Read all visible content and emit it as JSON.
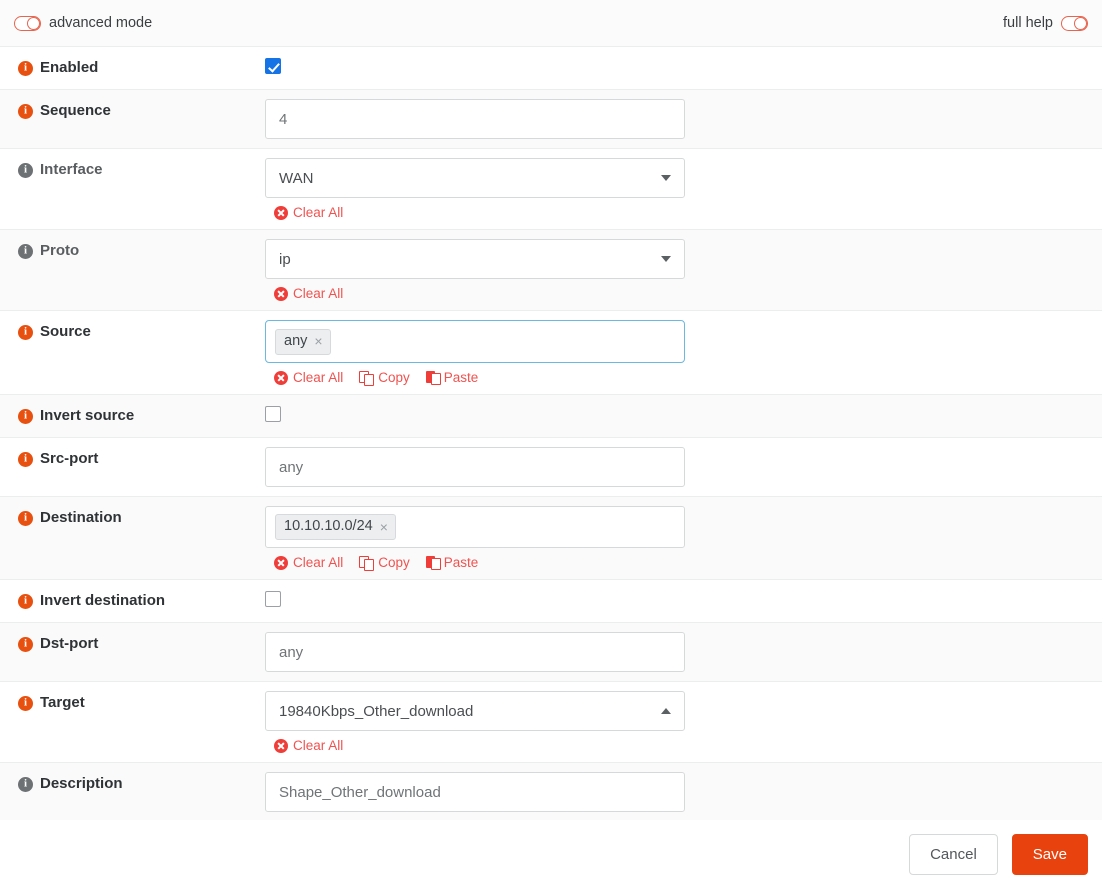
{
  "topbar": {
    "advanced_mode_label": "advanced mode",
    "advanced_mode_icon": "toggle-pill-icon",
    "full_help_label": "full help",
    "full_help_icon": "toggle-pill-icon"
  },
  "colors": {
    "accent_orange": "#e8500f",
    "save_button": "#e8430e",
    "action_red": "#ef5350",
    "checkbox_blue": "#1573e6",
    "focus_border": "#6bb8e0",
    "row_alt_bg": "#fafafa",
    "info_icon_grey": "#6d7174"
  },
  "actions": {
    "clear_all": "Clear All",
    "copy": "Copy",
    "paste": "Paste"
  },
  "rows": {
    "enabled": {
      "label": "Enabled",
      "checked": true
    },
    "sequence": {
      "label": "Sequence",
      "value": "4"
    },
    "interface": {
      "label": "Interface",
      "value": "WAN"
    },
    "proto": {
      "label": "Proto",
      "value": "ip"
    },
    "source": {
      "label": "Source",
      "chip": "any",
      "chip_remove": "×"
    },
    "invert_source": {
      "label": "Invert source",
      "checked": false
    },
    "src_port": {
      "label": "Src-port",
      "value": "any"
    },
    "destination": {
      "label": "Destination",
      "chip": "10.10.10.0/24",
      "chip_remove": "×"
    },
    "invert_destination": {
      "label": "Invert destination",
      "checked": false
    },
    "dst_port": {
      "label": "Dst-port",
      "value": "any"
    },
    "target": {
      "label": "Target",
      "value": "19840Kbps_Other_download"
    },
    "description": {
      "label": "Description",
      "value": "Shape_Other_download"
    }
  },
  "footer": {
    "cancel_label": "Cancel",
    "save_label": "Save"
  },
  "info_glyph": "i"
}
